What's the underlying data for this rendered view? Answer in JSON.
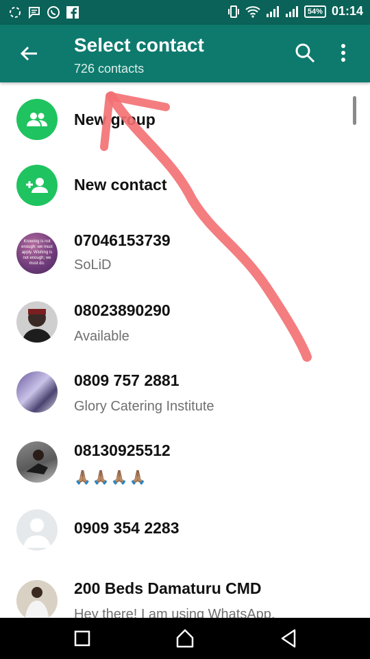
{
  "status_bar": {
    "time": "01:14",
    "battery": "54%",
    "icons": [
      "sync-icon",
      "message-icon",
      "whatsapp-icon",
      "facebook-icon",
      "vibrate-icon",
      "wifi-icon",
      "signal-icon",
      "signal-icon",
      "battery-icon"
    ]
  },
  "header": {
    "title": "Select contact",
    "subtitle": "726 contacts",
    "icons": [
      "back-arrow-icon",
      "search-icon",
      "more-vert-icon"
    ]
  },
  "actions": [
    {
      "label": "New group",
      "icon": "group-icon"
    },
    {
      "label": "New contact",
      "icon": "add-contact-icon"
    }
  ],
  "contacts": [
    {
      "name": "07046153739",
      "status": "SoLiD",
      "avatar_text": "Knowing is not enough; we must apply. Wishing is not enough; we must do."
    },
    {
      "name": "08023890290",
      "status": "Available"
    },
    {
      "name": "0809 757 2881",
      "status": "Glory Catering Institute"
    },
    {
      "name": "08130925512",
      "status": "🙏🏽🙏🏽🙏🏽🙏🏽"
    },
    {
      "name": "0909 354 2283",
      "status": ""
    },
    {
      "name": "200 Beds Damaturu CMD",
      "status": "Hey there! I am using WhatsApp."
    }
  ],
  "colors": {
    "status_bar": "#0a6258",
    "app_bar": "#0e7a6e",
    "accent_green": "#1fc360",
    "annotation": "#f36f72"
  }
}
